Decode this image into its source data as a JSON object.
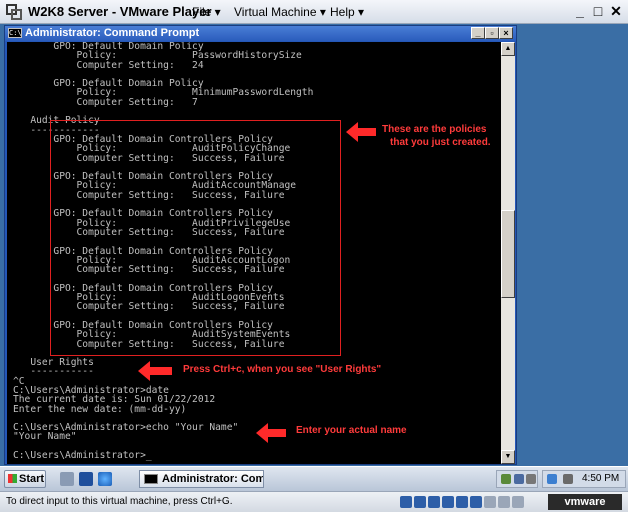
{
  "vm": {
    "title": "W2K8 Server - VMware Player",
    "menu": [
      "File",
      "Virtual Machine",
      "Help"
    ],
    "status_text": "To direct input to this virtual machine, press Ctrl+G.",
    "brand": "vmware"
  },
  "cmd": {
    "title": "Administrator: Command Prompt",
    "lines": [
      "       GPO: Default Domain Policy",
      "           Policy:             PasswordHistorySize",
      "           Computer Setting:   24",
      "",
      "       GPO: Default Domain Policy",
      "           Policy:             MinimumPasswordLength",
      "           Computer Setting:   7",
      "",
      "   Audit Policy",
      "   ------------",
      "       GPO: Default Domain Controllers Policy",
      "           Policy:             AuditPolicyChange",
      "           Computer Setting:   Success, Failure",
      "",
      "       GPO: Default Domain Controllers Policy",
      "           Policy:             AuditAccountManage",
      "           Computer Setting:   Success, Failure",
      "",
      "       GPO: Default Domain Controllers Policy",
      "           Policy:             AuditPrivilegeUse",
      "           Computer Setting:   Success, Failure",
      "",
      "       GPO: Default Domain Controllers Policy",
      "           Policy:             AuditAccountLogon",
      "           Computer Setting:   Success, Failure",
      "",
      "       GPO: Default Domain Controllers Policy",
      "           Policy:             AuditLogonEvents",
      "           Computer Setting:   Success, Failure",
      "",
      "       GPO: Default Domain Controllers Policy",
      "           Policy:             AuditSystemEvents",
      "           Computer Setting:   Success, Failure",
      "",
      "   User Rights",
      "   -----------",
      "^C",
      "C:\\Users\\Administrator>date",
      "The current date is: Sun 01/22/2012",
      "Enter the new date: (mm-dd-yy)",
      "",
      "C:\\Users\\Administrator>echo \"Your Name\"",
      "\"Your Name\"",
      "",
      "C:\\Users\\Administrator>_"
    ]
  },
  "annotations": {
    "policies_note_line1": "These are the policies",
    "policies_note_line2": "that you just created.",
    "user_rights_note": "Press Ctrl+c, when you see \"User Rights\"",
    "name_note": "Enter your actual name"
  },
  "taskbar": {
    "start_label": "Start",
    "task_label": "Administrator: Comm...",
    "clock": "4:50 PM"
  }
}
